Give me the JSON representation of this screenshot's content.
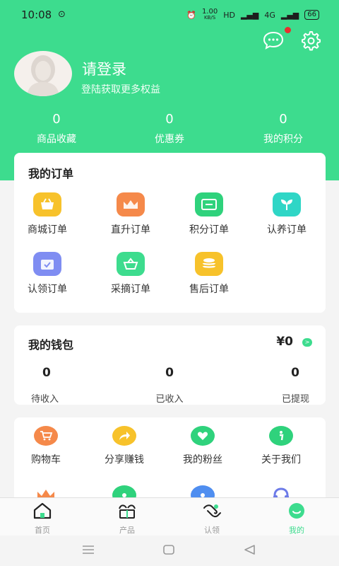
{
  "status_bar": {
    "time": "10:08",
    "speed": "1.00",
    "speed_unit": "KB/S",
    "hd": "HD",
    "network": "4G",
    "battery": "66"
  },
  "profile": {
    "login_title": "请登录",
    "login_subtitle": "登陆获取更多权益"
  },
  "stats": [
    {
      "value": "0",
      "label": "商品收藏"
    },
    {
      "value": "0",
      "label": "优惠券"
    },
    {
      "value": "0",
      "label": "我的积分"
    }
  ],
  "orders": {
    "title": "我的订单",
    "items": [
      {
        "label": "商城订单",
        "icon": "basket-icon",
        "color": "#f7c22b"
      },
      {
        "label": "直升订单",
        "icon": "crown-icon",
        "color": "#f5894a"
      },
      {
        "label": "积分订单",
        "icon": "card-icon",
        "color": "#2fd27c"
      },
      {
        "label": "认养订单",
        "icon": "sprout-icon",
        "color": "#2fd6c6"
      },
      {
        "label": "认领订单",
        "icon": "calendar-check-icon",
        "color": "#7f8df2"
      },
      {
        "label": "采摘订单",
        "icon": "harvest-basket-icon",
        "color": "#3ddc8e"
      },
      {
        "label": "售后订单",
        "icon": "coins-icon",
        "color": "#f7c22b"
      }
    ]
  },
  "wallet": {
    "title": "我的钱包",
    "amount": "¥0",
    "arrow": ">",
    "stats": [
      {
        "value": "0",
        "label": "待收入"
      },
      {
        "value": "0",
        "label": "已收入"
      },
      {
        "value": "0",
        "label": "已提现"
      }
    ]
  },
  "tools": {
    "items": [
      {
        "label": "购物车",
        "icon": "cart-icon",
        "color": "#f5894a"
      },
      {
        "label": "分享赚钱",
        "icon": "share-icon",
        "color": "#f7c22b"
      },
      {
        "label": "我的粉丝",
        "icon": "heart-icon",
        "color": "#2fd27c"
      },
      {
        "label": "关于我们",
        "icon": "info-icon",
        "color": "#2fd27c"
      }
    ],
    "partial_icons": [
      {
        "icon": "crown-icon",
        "color": "#f5894a"
      },
      {
        "icon": "location-icon",
        "color": "#2fd27c"
      },
      {
        "icon": "flower-icon",
        "color": "#4f8ef0"
      },
      {
        "icon": "headset-icon",
        "color": "#6d7be8"
      }
    ]
  },
  "tabbar": {
    "tabs": [
      {
        "label": "首页",
        "icon": "home-icon"
      },
      {
        "label": "产品",
        "icon": "product-icon"
      },
      {
        "label": "认领",
        "icon": "claim-hand-icon"
      },
      {
        "label": "我的",
        "icon": "profile-icon",
        "active": true
      }
    ]
  },
  "theme": {
    "accent": "#3ddc8e"
  }
}
